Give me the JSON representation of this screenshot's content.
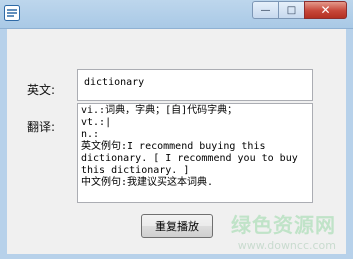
{
  "window": {
    "controls": {
      "minimize": "—",
      "maximize": "□",
      "close": "✕"
    }
  },
  "form": {
    "word_label": "英文:",
    "word_value": "dictionary",
    "translation_label": "翻译:",
    "translation_lines": [
      "vi.:词典，字典；[自]代码字典；",
      "vt.:|",
      "n.:",
      "英文例句:I recommend buying this",
      "dictionary. [ I recommend you to buy",
      "this dictionary. ]",
      "中文例句:我建议买这本词典."
    ],
    "play_button": "重复播放"
  },
  "watermark": {
    "title": "绿色资源网",
    "url": "www.downcc.com"
  }
}
